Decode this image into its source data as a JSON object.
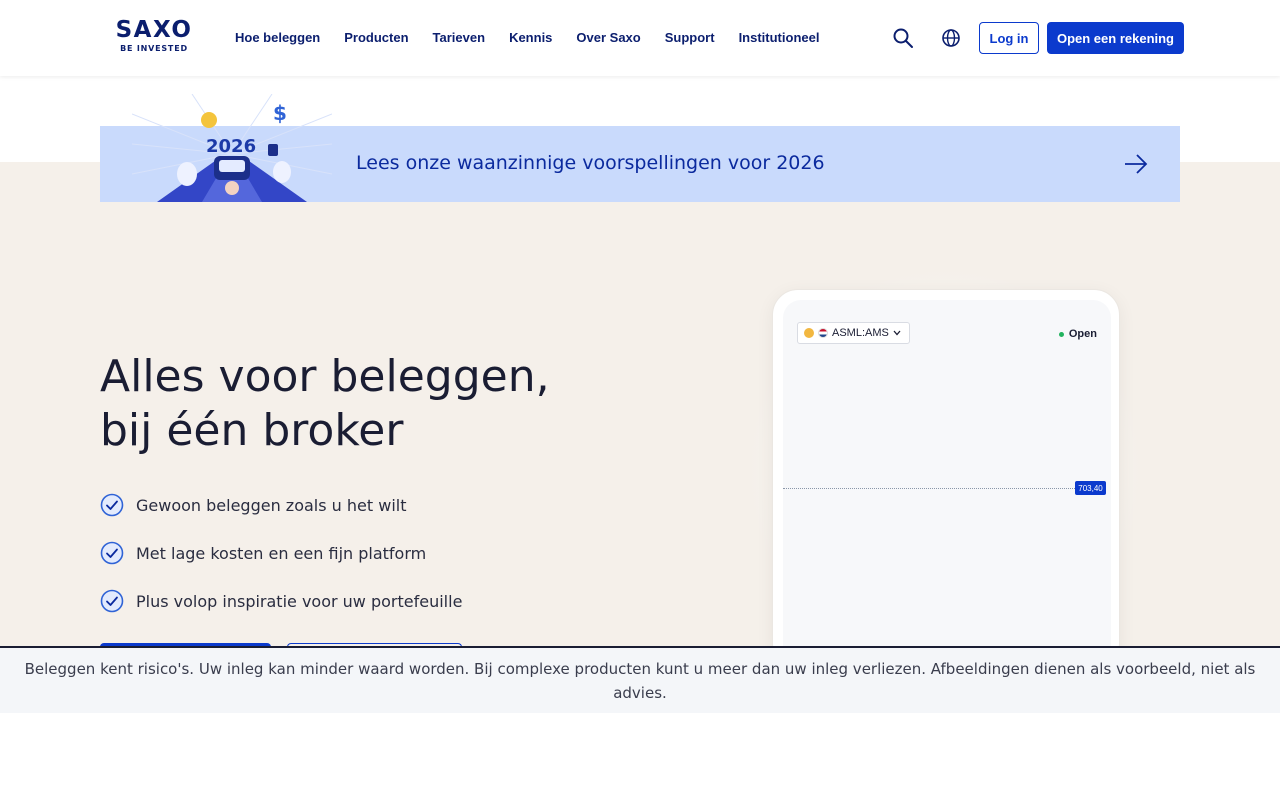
{
  "header": {
    "logo": {
      "word": "SAXO",
      "tagline": "BE INVESTED"
    },
    "nav": [
      {
        "label": "Hoe beleggen"
      },
      {
        "label": "Producten"
      },
      {
        "label": "Tarieven"
      },
      {
        "label": "Kennis"
      },
      {
        "label": "Over Saxo"
      },
      {
        "label": "Support"
      },
      {
        "label": "Institutioneel"
      }
    ],
    "icons": {
      "search": "search-icon",
      "language": "globe-icon"
    },
    "login_label": "Log in",
    "open_account_label": "Open een rekening"
  },
  "banner": {
    "text": "Lees onze waanzinnige voorspellingen voor 2026",
    "art_year": "2026",
    "arrow_icon": "arrow-right-icon"
  },
  "hero": {
    "title_line1": "Alles voor beleggen,",
    "title_line2": "bij één broker",
    "bullets": [
      {
        "text": "Gewoon beleggen zoals u het wilt"
      },
      {
        "text": "Met lage kosten en een fijn platform"
      },
      {
        "text": "Plus volop inspiratie voor uw portefeuille"
      }
    ]
  },
  "phone": {
    "ticker": "ASML:AMS",
    "status": "Open",
    "price": "703,40"
  },
  "disclaimer": {
    "text": "Beleggen kent risico's. Uw inleg kan minder waard worden. Bij complexe producten kunt u meer dan uw inleg verliezen. Afbeeldingen dienen als voorbeeld, niet als advies."
  },
  "colors": {
    "brand_navy": "#0b1e6e",
    "brand_blue": "#0b3acd",
    "banner_bg": "#c9dafc",
    "hero_bg": "#f5f0ea",
    "status_green": "#22b35e"
  }
}
